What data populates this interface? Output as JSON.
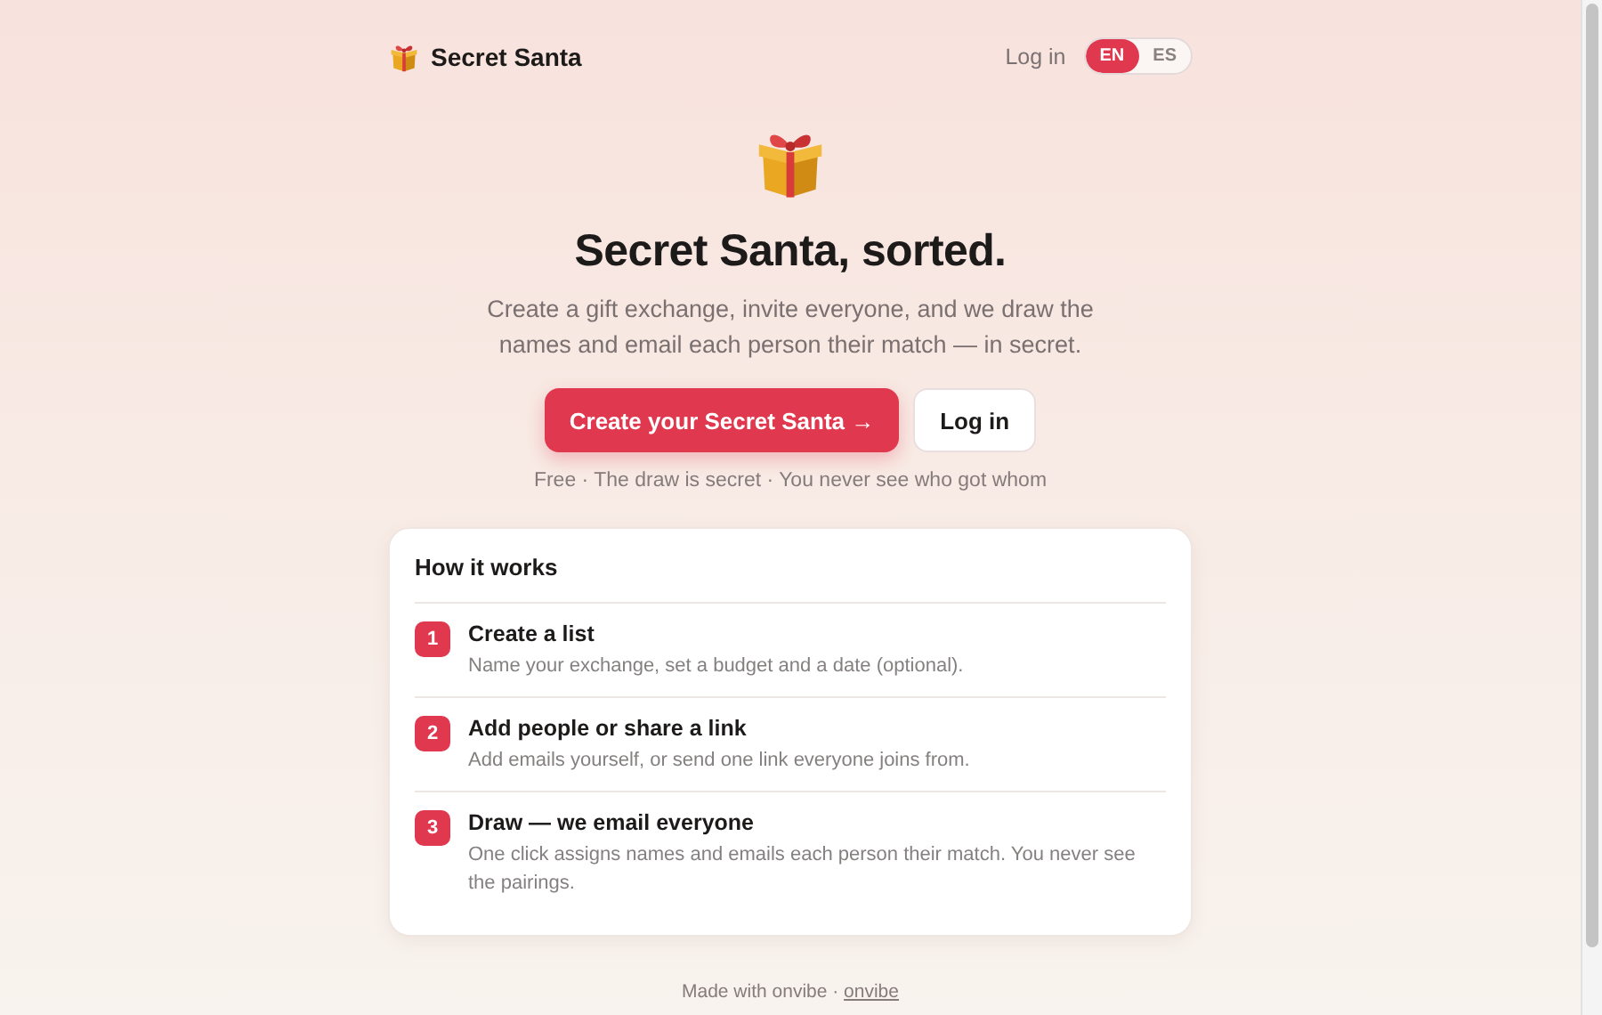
{
  "header": {
    "brand": "Secret Santa",
    "login": "Log in",
    "languages": [
      {
        "code": "EN",
        "selected": true
      },
      {
        "code": "ES",
        "selected": false
      }
    ]
  },
  "hero": {
    "title": "Secret Santa, sorted.",
    "subtitle": "Create a gift exchange, invite everyone, and we draw the names and email each person their match — in secret.",
    "primary_button": "Create your Secret Santa →",
    "secondary_button": "Log in",
    "tagline": "Free · The draw is secret · You never see who got whom"
  },
  "how_it_works": {
    "title": "How it works",
    "steps": [
      {
        "number": "1",
        "title": "Create a list",
        "description": "Name your exchange, set a budget and a date (optional)."
      },
      {
        "number": "2",
        "title": "Add people or share a link",
        "description": "Add emails yourself, or send one link everyone joins from."
      },
      {
        "number": "3",
        "title": "Draw — we email everyone",
        "description": "One click assigns names and emails each person their match. You never see the pairings."
      }
    ]
  },
  "footer": {
    "text": "Made with onvibe · ",
    "link": "onvibe"
  }
}
